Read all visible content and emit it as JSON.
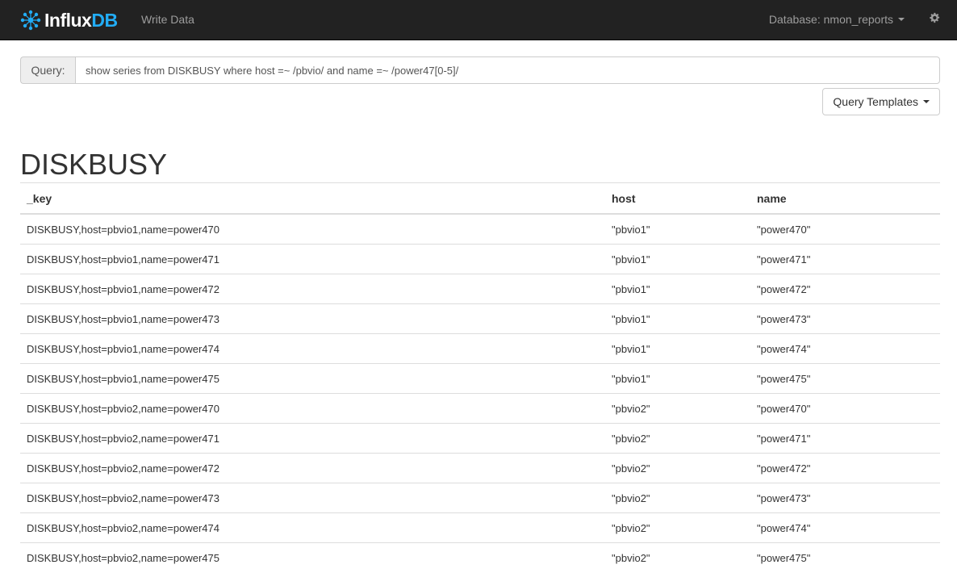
{
  "brand": {
    "part1": "Influx",
    "part2": "DB",
    "accent_color": "#22adf6"
  },
  "nav": {
    "write_data": "Write Data",
    "database_label": "Database: nmon_reports",
    "settings_icon": "gear-icon"
  },
  "query": {
    "label": "Query:",
    "value": "show series from DISKBUSY where host =~ /pbvio/ and name =~ /power47[0-5]/"
  },
  "templates_button": "Query Templates",
  "series": {
    "title": "DISKBUSY",
    "columns": [
      "_key",
      "host",
      "name"
    ],
    "rows": [
      [
        "DISKBUSY,host=pbvio1,name=power470",
        "\"pbvio1\"",
        "\"power470\""
      ],
      [
        "DISKBUSY,host=pbvio1,name=power471",
        "\"pbvio1\"",
        "\"power471\""
      ],
      [
        "DISKBUSY,host=pbvio1,name=power472",
        "\"pbvio1\"",
        "\"power472\""
      ],
      [
        "DISKBUSY,host=pbvio1,name=power473",
        "\"pbvio1\"",
        "\"power473\""
      ],
      [
        "DISKBUSY,host=pbvio1,name=power474",
        "\"pbvio1\"",
        "\"power474\""
      ],
      [
        "DISKBUSY,host=pbvio1,name=power475",
        "\"pbvio1\"",
        "\"power475\""
      ],
      [
        "DISKBUSY,host=pbvio2,name=power470",
        "\"pbvio2\"",
        "\"power470\""
      ],
      [
        "DISKBUSY,host=pbvio2,name=power471",
        "\"pbvio2\"",
        "\"power471\""
      ],
      [
        "DISKBUSY,host=pbvio2,name=power472",
        "\"pbvio2\"",
        "\"power472\""
      ],
      [
        "DISKBUSY,host=pbvio2,name=power473",
        "\"pbvio2\"",
        "\"power473\""
      ],
      [
        "DISKBUSY,host=pbvio2,name=power474",
        "\"pbvio2\"",
        "\"power474\""
      ],
      [
        "DISKBUSY,host=pbvio2,name=power475",
        "\"pbvio2\"",
        "\"power475\""
      ]
    ]
  }
}
